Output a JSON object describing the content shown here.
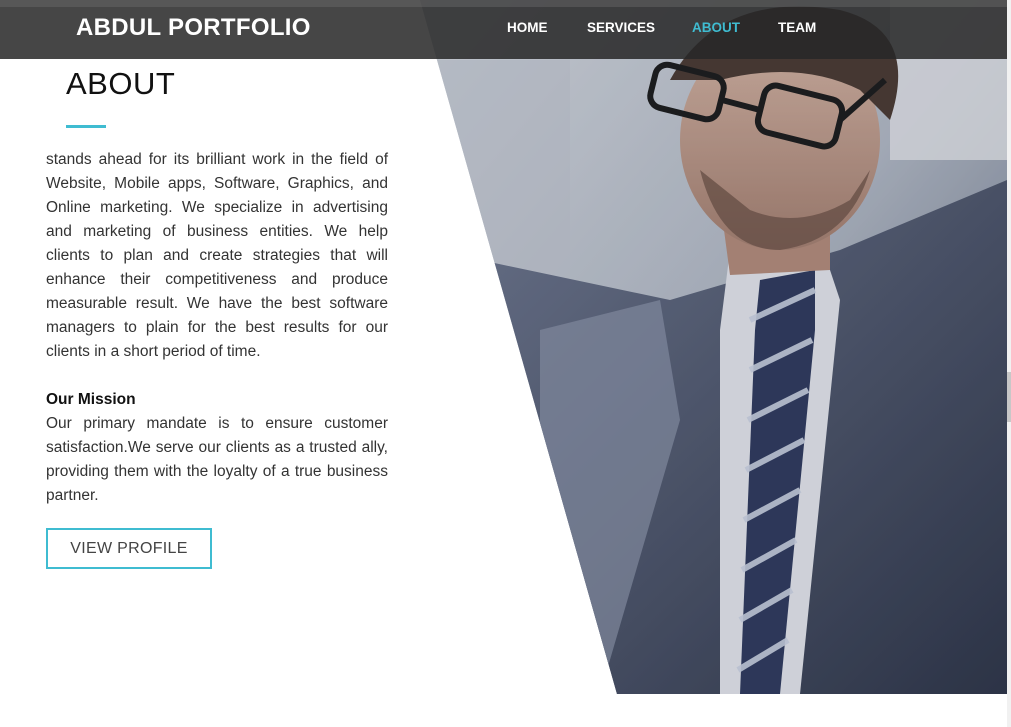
{
  "header": {
    "brand": "ABDUL PORTFOLIO",
    "nav": [
      {
        "label": "HOME",
        "active": false
      },
      {
        "label": "SERVICES",
        "active": false
      },
      {
        "label": "ABOUT",
        "active": true
      },
      {
        "label": "TEAM",
        "active": false
      }
    ]
  },
  "about": {
    "title": "ABOUT",
    "intro": "stands ahead for its brilliant work in the field of Website, Mobile apps, Software, Graphics, and Online marketing. We specialize in advertising and marketing of business entities. We help clients to plan and create strategies that will enhance their competitiveness and produce measurable result. We have the best software managers to plain for the best results for our clients in a short period of time.",
    "mission_heading": "Our Mission",
    "mission_text": "Our primary mandate is to ensure customer satisfaction.We serve our clients as a trusted ally, providing them with the loyalty of a true business partner.",
    "button_label": "VIEW PROFILE"
  },
  "colors": {
    "accent": "#3fbcd1",
    "header_bg": "#2a2a2a",
    "text": "#333333"
  }
}
